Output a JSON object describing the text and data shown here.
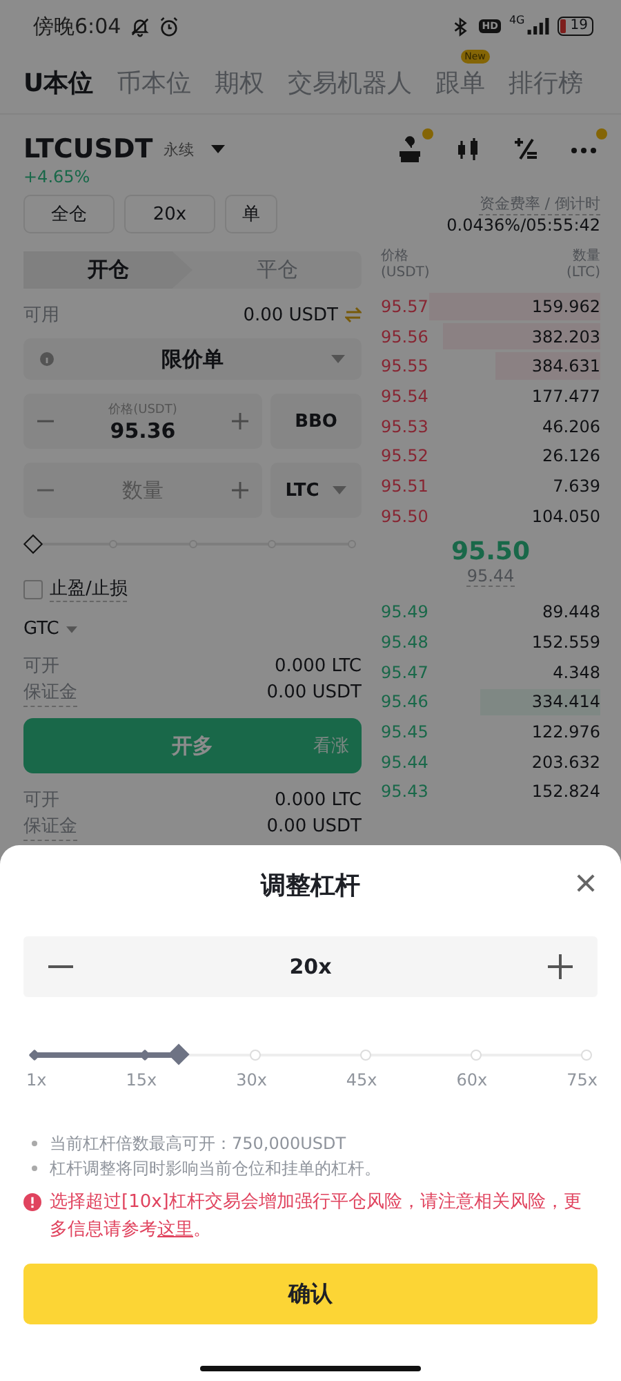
{
  "status_bar": {
    "time": "傍晚6:04",
    "hd": "HD",
    "network": "4G",
    "battery": "19"
  },
  "nav_tabs": [
    {
      "label": "U本位",
      "selected": true
    },
    {
      "label": "币本位",
      "selected": false
    },
    {
      "label": "期权",
      "selected": false
    },
    {
      "label": "交易机器人",
      "selected": false
    },
    {
      "label": "跟单",
      "selected": false,
      "badge": "New"
    },
    {
      "label": "排行榜",
      "selected": false
    }
  ],
  "symbol": {
    "name": "LTCUSDT",
    "tag": "永续",
    "change": "+4.65%"
  },
  "toolbar_icons": [
    {
      "kind": "help",
      "dot": true
    },
    {
      "kind": "candles",
      "dot": false
    },
    {
      "kind": "calc",
      "dot": false
    },
    {
      "kind": "more",
      "dot": true
    }
  ],
  "order_options": [
    "全仓",
    "20x",
    "单"
  ],
  "funding": {
    "label": "资金费率 / 倒计时",
    "value": "0.0436%/05:55:42"
  },
  "position_tabs": [
    {
      "label": "开仓",
      "selected": true
    },
    {
      "label": "平仓",
      "selected": false
    }
  ],
  "available": {
    "label": "可用",
    "value": "0.00 USDT"
  },
  "order_type": "限价单",
  "price_field": {
    "label": "价格(USDT)",
    "value": "95.36",
    "side_button": "BBO"
  },
  "quantity_field": {
    "placeholder": "数量",
    "unit": "LTC"
  },
  "amount_slider": {
    "level": 0
  },
  "tp_sl": {
    "label": "止盈/止损",
    "checked": false
  },
  "time_in_force": "GTC",
  "long_info": [
    {
      "label": "可开",
      "value": "0.000 LTC"
    },
    {
      "label": "保证金",
      "value": "0.00 USDT"
    }
  ],
  "long_button": {
    "label": "开多",
    "hint": "看涨"
  },
  "short_info": [
    {
      "label": "可开",
      "value": "0.000 LTC"
    },
    {
      "label": "保证金",
      "value": "0.00 USDT"
    }
  ],
  "order_book": {
    "price_header": "价格",
    "price_unit": "(USDT)",
    "qty_header": "数量",
    "qty_unit": "(LTC)",
    "asks": [
      {
        "price": "95.57",
        "qty": "159.962"
      },
      {
        "price": "95.56",
        "qty": "382.203"
      },
      {
        "price": "95.55",
        "qty": "384.631"
      },
      {
        "price": "95.54",
        "qty": "177.477"
      },
      {
        "price": "95.53",
        "qty": "46.206"
      },
      {
        "price": "95.52",
        "qty": "26.126"
      },
      {
        "price": "95.51",
        "qty": "7.639"
      },
      {
        "price": "95.50",
        "qty": "104.050"
      }
    ],
    "last_price": "95.50",
    "mark_price": "95.44",
    "bids": [
      {
        "price": "95.49",
        "qty": "89.448"
      },
      {
        "price": "95.48",
        "qty": "152.559"
      },
      {
        "price": "95.47",
        "qty": "4.348"
      },
      {
        "price": "95.46",
        "qty": "334.414"
      },
      {
        "price": "95.45",
        "qty": "122.976"
      },
      {
        "price": "95.44",
        "qty": "203.632"
      },
      {
        "price": "95.43",
        "qty": "152.824"
      }
    ]
  },
  "leverage_sheet": {
    "title": "调整杠杆",
    "value": "20x",
    "level": 0.26,
    "marks": [
      "1x",
      "15x",
      "30x",
      "45x",
      "60x",
      "75x"
    ],
    "notes": [
      "当前杠杆倍数最高可开：750,000USDT",
      "杠杆调整将同时影响当前仓位和挂单的杠杆。"
    ],
    "warning": "选择超过[10x]杠杆交易会增加强行平仓风险，请注意相关风险，更多信息请参考",
    "link": "这里",
    "warning_end": "。",
    "confirm": "确认"
  }
}
